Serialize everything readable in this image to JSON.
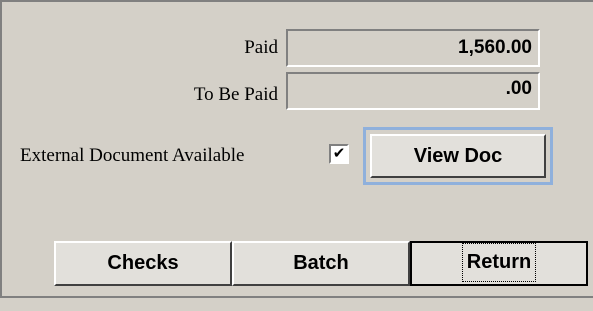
{
  "paid": {
    "label": "Paid",
    "value": "1,560.00"
  },
  "to_be_paid": {
    "label": "To Be Paid",
    "value": ".00"
  },
  "external_doc": {
    "label": "External Document Available",
    "checked_glyph": "✔"
  },
  "buttons": {
    "view_doc": "View Doc",
    "checks": "Checks",
    "batch": "Batch",
    "return": "Return"
  },
  "colors": {
    "background": "#d4d0c8",
    "focus_ring": "#8fb0dc"
  }
}
